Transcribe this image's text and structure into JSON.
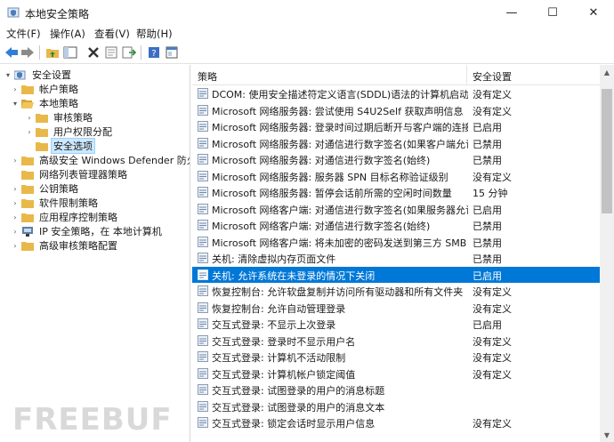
{
  "window": {
    "title": "本地安全策略",
    "minimize": "—",
    "maximize": "☐",
    "close": "✕"
  },
  "menu": [
    "文件(F)",
    "操作(A)",
    "查看(V)",
    "帮助(H)"
  ],
  "toolbar": [
    "back-arrow-icon",
    "forward-arrow-icon",
    "up-folder-icon",
    "show-hide-tree-icon",
    "delete-icon",
    "properties-icon",
    "export-list-icon",
    "help-icon",
    "console-icon"
  ],
  "tree": [
    {
      "label": "安全设置",
      "level": 0,
      "exp": "▾",
      "icon": "shield"
    },
    {
      "label": "帐户策略",
      "level": 1,
      "exp": "›",
      "icon": "folder"
    },
    {
      "label": "本地策略",
      "level": 1,
      "exp": "▾",
      "icon": "folder"
    },
    {
      "label": "审核策略",
      "level": 2,
      "exp": "›",
      "icon": "folder"
    },
    {
      "label": "用户权限分配",
      "level": 2,
      "exp": "›",
      "icon": "folder"
    },
    {
      "label": "安全选项",
      "level": 2,
      "exp": "",
      "icon": "folder",
      "selected": true
    },
    {
      "label": "高级安全 Windows Defender 防火墙",
      "level": 1,
      "exp": "›",
      "icon": "folder"
    },
    {
      "label": "网络列表管理器策略",
      "level": 1,
      "exp": "",
      "icon": "folder"
    },
    {
      "label": "公钥策略",
      "level": 1,
      "exp": "›",
      "icon": "folder"
    },
    {
      "label": "软件限制策略",
      "level": 1,
      "exp": "›",
      "icon": "folder"
    },
    {
      "label": "应用程序控制策略",
      "level": 1,
      "exp": "›",
      "icon": "folder"
    },
    {
      "label": "IP 安全策略，在 本地计算机",
      "level": 1,
      "exp": "›",
      "icon": "ipsec"
    },
    {
      "label": "高级审核策略配置",
      "level": 1,
      "exp": "›",
      "icon": "folder"
    }
  ],
  "list": {
    "col_policy": "策略",
    "col_setting": "安全设置",
    "rows": [
      {
        "policy": "DCOM: 使用安全描述符定义语言(SDDL)语法的计算机启动...",
        "setting": "没有定义"
      },
      {
        "policy": "Microsoft 网络服务器: 尝试使用 S4U2Self 获取声明信息",
        "setting": "没有定义"
      },
      {
        "policy": "Microsoft 网络服务器: 登录时间过期后断开与客户端的连接",
        "setting": "已启用"
      },
      {
        "policy": "Microsoft 网络服务器: 对通信进行数字签名(如果客户端允许)",
        "setting": "已禁用"
      },
      {
        "policy": "Microsoft 网络服务器: 对通信进行数字签名(始终)",
        "setting": "已禁用"
      },
      {
        "policy": "Microsoft 网络服务器: 服务器 SPN 目标名称验证级别",
        "setting": "没有定义"
      },
      {
        "policy": "Microsoft 网络服务器: 暂停会话前所需的空闲时间数量",
        "setting": "15 分钟"
      },
      {
        "policy": "Microsoft 网络客户端: 对通信进行数字签名(如果服务器允许)",
        "setting": "已启用"
      },
      {
        "policy": "Microsoft 网络客户端: 对通信进行数字签名(始终)",
        "setting": "已禁用"
      },
      {
        "policy": "Microsoft 网络客户端: 将未加密的密码发送到第三方 SMB ...",
        "setting": "已禁用"
      },
      {
        "policy": "关机: 清除虚拟内存页面文件",
        "setting": "已禁用"
      },
      {
        "policy": "关机: 允许系统在未登录的情况下关闭",
        "setting": "已启用",
        "selected": true
      },
      {
        "policy": "恢复控制台: 允许软盘复制并访问所有驱动器和所有文件夹",
        "setting": "没有定义"
      },
      {
        "policy": "恢复控制台: 允许自动管理登录",
        "setting": "没有定义"
      },
      {
        "policy": "交互式登录: 不显示上次登录",
        "setting": "已启用"
      },
      {
        "policy": "交互式登录: 登录时不显示用户名",
        "setting": "没有定义"
      },
      {
        "policy": "交互式登录: 计算机不活动限制",
        "setting": "没有定义"
      },
      {
        "policy": "交互式登录: 计算机帐户锁定阈值",
        "setting": "没有定义"
      },
      {
        "policy": "交互式登录: 试图登录的用户的消息标题",
        "setting": ""
      },
      {
        "policy": "交互式登录: 试图登录的用户的消息文本",
        "setting": ""
      },
      {
        "policy": "交互式登录: 锁定会话时显示用户信息",
        "setting": "没有定义"
      }
    ]
  },
  "watermark": "FREEBUF",
  "colors": {
    "selection": "#0078d7",
    "tree_selection": "#cce8ff",
    "folder": "#e8b94a"
  }
}
